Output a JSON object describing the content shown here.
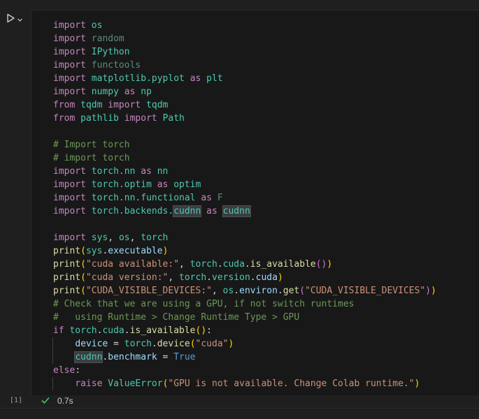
{
  "cell": {
    "execution_count": "[1]",
    "status_time": "0.7s",
    "status_icon": "check-icon",
    "run_icon": "play-icon",
    "run_menu_icon": "chevron-down-icon"
  },
  "code_lines": [
    [
      {
        "t": "import",
        "c": "kw"
      },
      {
        "t": " ",
        "c": "pl"
      },
      {
        "t": "os",
        "c": "mod"
      }
    ],
    [
      {
        "t": "import",
        "c": "kw"
      },
      {
        "t": " ",
        "c": "pl"
      },
      {
        "t": "random",
        "c": "dimteal"
      }
    ],
    [
      {
        "t": "import",
        "c": "kw"
      },
      {
        "t": " ",
        "c": "pl"
      },
      {
        "t": "IPython",
        "c": "mod"
      }
    ],
    [
      {
        "t": "import",
        "c": "kw"
      },
      {
        "t": " ",
        "c": "pl"
      },
      {
        "t": "functools",
        "c": "dimteal"
      }
    ],
    [
      {
        "t": "import",
        "c": "kw"
      },
      {
        "t": " ",
        "c": "pl"
      },
      {
        "t": "matplotlib.pyplot",
        "c": "mod"
      },
      {
        "t": " ",
        "c": "pl"
      },
      {
        "t": "as",
        "c": "kw"
      },
      {
        "t": " ",
        "c": "pl"
      },
      {
        "t": "plt",
        "c": "mod"
      }
    ],
    [
      {
        "t": "import",
        "c": "kw"
      },
      {
        "t": " ",
        "c": "pl"
      },
      {
        "t": "numpy",
        "c": "mod"
      },
      {
        "t": " ",
        "c": "pl"
      },
      {
        "t": "as",
        "c": "kw"
      },
      {
        "t": " ",
        "c": "pl"
      },
      {
        "t": "np",
        "c": "mod"
      }
    ],
    [
      {
        "t": "from",
        "c": "kw"
      },
      {
        "t": " ",
        "c": "pl"
      },
      {
        "t": "tqdm",
        "c": "mod"
      },
      {
        "t": " ",
        "c": "pl"
      },
      {
        "t": "import",
        "c": "kw"
      },
      {
        "t": " ",
        "c": "pl"
      },
      {
        "t": "tqdm",
        "c": "mod"
      }
    ],
    [
      {
        "t": "from",
        "c": "kw"
      },
      {
        "t": " ",
        "c": "pl"
      },
      {
        "t": "pathlib",
        "c": "mod"
      },
      {
        "t": " ",
        "c": "pl"
      },
      {
        "t": "import",
        "c": "kw"
      },
      {
        "t": " ",
        "c": "pl"
      },
      {
        "t": "Path",
        "c": "mod"
      }
    ],
    [],
    [
      {
        "t": "# Import torch",
        "c": "cm"
      }
    ],
    [
      {
        "t": "# import torch",
        "c": "cm"
      }
    ],
    [
      {
        "t": "import",
        "c": "kw"
      },
      {
        "t": " ",
        "c": "pl"
      },
      {
        "t": "torch.nn",
        "c": "mod"
      },
      {
        "t": " ",
        "c": "pl"
      },
      {
        "t": "as",
        "c": "kw"
      },
      {
        "t": " ",
        "c": "pl"
      },
      {
        "t": "nn",
        "c": "mod"
      }
    ],
    [
      {
        "t": "import",
        "c": "kw"
      },
      {
        "t": " ",
        "c": "pl"
      },
      {
        "t": "torch.optim",
        "c": "mod"
      },
      {
        "t": " ",
        "c": "pl"
      },
      {
        "t": "as",
        "c": "kw"
      },
      {
        "t": " ",
        "c": "pl"
      },
      {
        "t": "optim",
        "c": "mod"
      }
    ],
    [
      {
        "t": "import",
        "c": "kw"
      },
      {
        "t": " ",
        "c": "pl"
      },
      {
        "t": "torch.nn.functional",
        "c": "mod"
      },
      {
        "t": " ",
        "c": "pl"
      },
      {
        "t": "as",
        "c": "kw"
      },
      {
        "t": " ",
        "c": "pl"
      },
      {
        "t": "F",
        "c": "dimteal"
      }
    ],
    [
      {
        "t": "import",
        "c": "kw"
      },
      {
        "t": " ",
        "c": "pl"
      },
      {
        "t": "torch.backends.",
        "c": "mod"
      },
      {
        "t": "cudnn",
        "c": "mod hl"
      },
      {
        "t": " ",
        "c": "pl"
      },
      {
        "t": "as",
        "c": "kw"
      },
      {
        "t": " ",
        "c": "pl"
      },
      {
        "t": "cudnn",
        "c": "mod hl"
      }
    ],
    [],
    [
      {
        "t": "import",
        "c": "kw"
      },
      {
        "t": " ",
        "c": "pl"
      },
      {
        "t": "sys",
        "c": "mod"
      },
      {
        "t": ", ",
        "c": "pl"
      },
      {
        "t": "os",
        "c": "mod"
      },
      {
        "t": ", ",
        "c": "pl"
      },
      {
        "t": "torch",
        "c": "mod"
      }
    ],
    [
      {
        "t": "print",
        "c": "fn"
      },
      {
        "t": "(",
        "c": "bracket1"
      },
      {
        "t": "sys",
        "c": "mod"
      },
      {
        "t": ".",
        "c": "pl"
      },
      {
        "t": "executable",
        "c": "var"
      },
      {
        "t": ")",
        "c": "bracket1"
      }
    ],
    [
      {
        "t": "print",
        "c": "fn"
      },
      {
        "t": "(",
        "c": "bracket1"
      },
      {
        "t": "\"cuda available:\"",
        "c": "str"
      },
      {
        "t": ", ",
        "c": "pl"
      },
      {
        "t": "torch",
        "c": "mod"
      },
      {
        "t": ".",
        "c": "pl"
      },
      {
        "t": "cuda",
        "c": "mod"
      },
      {
        "t": ".",
        "c": "pl"
      },
      {
        "t": "is_available",
        "c": "fn"
      },
      {
        "t": "()",
        "c": "bracket2"
      },
      {
        "t": ")",
        "c": "bracket1"
      }
    ],
    [
      {
        "t": "print",
        "c": "fn"
      },
      {
        "t": "(",
        "c": "bracket1"
      },
      {
        "t": "\"cuda version:\"",
        "c": "str"
      },
      {
        "t": ", ",
        "c": "pl"
      },
      {
        "t": "torch",
        "c": "mod"
      },
      {
        "t": ".",
        "c": "pl"
      },
      {
        "t": "version",
        "c": "mod"
      },
      {
        "t": ".",
        "c": "pl"
      },
      {
        "t": "cuda",
        "c": "var"
      },
      {
        "t": ")",
        "c": "bracket1"
      }
    ],
    [
      {
        "t": "print",
        "c": "fn"
      },
      {
        "t": "(",
        "c": "bracket1"
      },
      {
        "t": "\"CUDA_VISIBLE_DEVICES:\"",
        "c": "str"
      },
      {
        "t": ", ",
        "c": "pl"
      },
      {
        "t": "os",
        "c": "mod"
      },
      {
        "t": ".",
        "c": "pl"
      },
      {
        "t": "environ",
        "c": "var"
      },
      {
        "t": ".",
        "c": "pl"
      },
      {
        "t": "get",
        "c": "fn"
      },
      {
        "t": "(",
        "c": "bracket2"
      },
      {
        "t": "\"CUDA_VISIBLE_DEVICES\"",
        "c": "str"
      },
      {
        "t": ")",
        "c": "bracket2"
      },
      {
        "t": ")",
        "c": "bracket1"
      }
    ],
    [
      {
        "t": "# Check that we are using a GPU, if not switch runtimes",
        "c": "cm"
      }
    ],
    [
      {
        "t": "#   using Runtime > Change Runtime Type > GPU",
        "c": "cm"
      }
    ],
    [
      {
        "t": "if",
        "c": "kw"
      },
      {
        "t": " ",
        "c": "pl"
      },
      {
        "t": "torch",
        "c": "mod"
      },
      {
        "t": ".",
        "c": "pl"
      },
      {
        "t": "cuda",
        "c": "mod"
      },
      {
        "t": ".",
        "c": "pl"
      },
      {
        "t": "is_available",
        "c": "fn"
      },
      {
        "t": "()",
        "c": "bracket1"
      },
      {
        "t": ":",
        "c": "pl"
      }
    ],
    [
      {
        "t": "    ",
        "c": "pl"
      },
      {
        "t": "device",
        "c": "var"
      },
      {
        "t": " = ",
        "c": "pl"
      },
      {
        "t": "torch",
        "c": "mod"
      },
      {
        "t": ".",
        "c": "pl"
      },
      {
        "t": "device",
        "c": "fn"
      },
      {
        "t": "(",
        "c": "bracket1"
      },
      {
        "t": "\"cuda\"",
        "c": "str"
      },
      {
        "t": ")",
        "c": "bracket1"
      }
    ],
    [
      {
        "t": "    ",
        "c": "pl"
      },
      {
        "t": "cudnn",
        "c": "mod hl"
      },
      {
        "t": ".",
        "c": "pl"
      },
      {
        "t": "benchmark",
        "c": "var"
      },
      {
        "t": " = ",
        "c": "pl"
      },
      {
        "t": "True",
        "c": "kb"
      }
    ],
    [
      {
        "t": "else",
        "c": "kw"
      },
      {
        "t": ":",
        "c": "pl"
      }
    ],
    [
      {
        "t": "    ",
        "c": "pl"
      },
      {
        "t": "raise",
        "c": "kw"
      },
      {
        "t": " ",
        "c": "pl"
      },
      {
        "t": "ValueError",
        "c": "mod"
      },
      {
        "t": "(",
        "c": "bracket1"
      },
      {
        "t": "\"GPU is not available. Change Colab runtime.\"",
        "c": "str"
      },
      {
        "t": ")",
        "c": "bracket1"
      }
    ]
  ]
}
